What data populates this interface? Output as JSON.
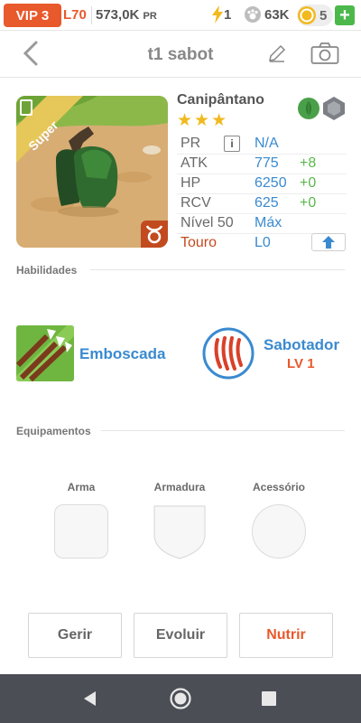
{
  "status_bar": {
    "vip": "VIP 3",
    "level": "L70",
    "power": "573,0K",
    "power_unit": "PR",
    "energy": "1",
    "paw_count": "63K",
    "coins": "5",
    "plus": "+"
  },
  "header": {
    "title": "t1 sabot",
    "back_icon": "chevron-left-icon",
    "edit_icon": "pencil-icon",
    "camera_icon": "camera-icon"
  },
  "monster": {
    "rarity_ribbon": "Super",
    "name": "Canipântano",
    "stars": "★★★",
    "elements": [
      "leaf-element-icon",
      "rock-element-icon"
    ],
    "stats": [
      {
        "label": "PR",
        "value": "N/A",
        "bonus": ""
      },
      {
        "label": "ATK",
        "value": "775",
        "bonus": "+8"
      },
      {
        "label": "HP",
        "value": "6250",
        "bonus": "+0"
      },
      {
        "label": "RCV",
        "value": "625",
        "bonus": "+0"
      },
      {
        "label": "Nível 50",
        "value": "Máx",
        "bonus": ""
      },
      {
        "label": "Touro",
        "value": "L0",
        "bonus": ""
      }
    ],
    "zodiac": "taurus-icon"
  },
  "abilities": {
    "section_title": "Habilidades",
    "active_name": "Emboscada",
    "passive_name": "Sabotador",
    "passive_level": "LV 1"
  },
  "equipment": {
    "section_title": "Equipamentos",
    "slots": [
      "Arma",
      "Armadura",
      "Acessório"
    ]
  },
  "actions": {
    "manage": "Gerir",
    "evolve": "Evoluir",
    "feed": "Nutrir"
  },
  "colors": {
    "accent_orange": "#e8592c",
    "accent_blue": "#3a8ad0",
    "bonus_green": "#59b84a",
    "star_gold": "#f1b91e"
  }
}
